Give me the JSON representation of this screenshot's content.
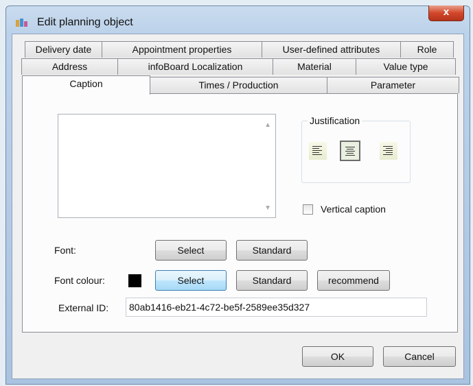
{
  "window": {
    "title": "Edit planning object",
    "close_label": "x"
  },
  "tabs": {
    "row1": [
      "Delivery date",
      "Appointment properties",
      "User-defined attributes",
      "Role"
    ],
    "row2": [
      "Address",
      "infoBoard Localization",
      "Material",
      "Value type"
    ],
    "row3": [
      "Caption",
      "Times / Production",
      "Parameter"
    ],
    "active": "Caption"
  },
  "justification": {
    "label": "Justification",
    "options": [
      "left",
      "center",
      "right"
    ],
    "selected": "center"
  },
  "vertical_caption": {
    "label": "Vertical caption",
    "checked": false
  },
  "font": {
    "label": "Font:",
    "select_label": "Select",
    "standard_label": "Standard"
  },
  "font_colour": {
    "label": "Font colour:",
    "swatch_color": "#000000",
    "select_label": "Select",
    "standard_label": "Standard",
    "recommend_label": "recommend"
  },
  "external_id": {
    "label": "External ID:",
    "value": "80ab1416-eb21-4c72-be5f-2589ee35d327"
  },
  "footer": {
    "ok_label": "OK",
    "cancel_label": "Cancel"
  }
}
